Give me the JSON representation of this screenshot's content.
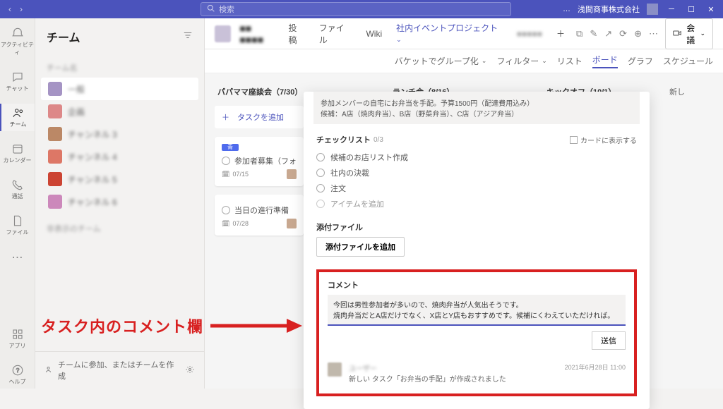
{
  "titlebar": {
    "search_placeholder": "検索",
    "org_name": "浅間商事株式会社",
    "ellipsis": "…"
  },
  "rail": {
    "activity": "アクティビティ",
    "chat": "チャット",
    "teams": "チーム",
    "calendar": "カレンダー",
    "calls": "通話",
    "files": "ファイル",
    "apps": "アプリ",
    "help": "ヘルプ"
  },
  "teams_panel": {
    "title": "チーム",
    "team_label_1": "チーム名",
    "ch1": "一般",
    "ch2": "企画",
    "ch3": "チャンネル 3",
    "ch4": "チャンネル 4",
    "ch5": "チャンネル 5",
    "ch6": "チャンネル 6",
    "hidden_label": "非表示のチーム",
    "footer": "チームに参加、またはチームを作成"
  },
  "channel_header": {
    "name": "■■ ■■■■",
    "tab_posts": "投稿",
    "tab_files": "ファイル",
    "tab_wiki": "Wiki",
    "tab_project": "社内イベントプロジェクト",
    "tab_other": "■■■■■",
    "meet_label": "会議"
  },
  "toolbar2": {
    "filter_bucket": "バケットでグループ化",
    "filter": "フィルター",
    "list": "リスト",
    "board": "ボード",
    "chart": "グラフ",
    "schedule": "スケジュール"
  },
  "board": {
    "col1_title": "パパママ座談会（7/30）",
    "col2_title": "ランチ会（8/16）",
    "col3_title": "キックオフ（10/1）",
    "add_task": "＋　タスクを追加",
    "new_list": "新し",
    "card1": {
      "tag": "青",
      "title": "参加者募集（フォ",
      "date": "07/15"
    },
    "card2": {
      "title": "当日の進行準備",
      "date": "07/28"
    }
  },
  "task": {
    "desc_line1": "参加メンバーの自宅にお弁当を手配。予算1500円（配達費用込み）",
    "desc_line2": "候補：A店（焼肉弁当）、B店（野菜弁当）、C店（アジア弁当）",
    "checklist_label": "チェックリスト",
    "checklist_count": "0/3",
    "display_in_card": "カードに表示する",
    "chk1": "候補のお店リスト作成",
    "chk2": "社内の決裁",
    "chk3": "注文",
    "chk_add": "アイテムを追加",
    "attach_label": "添付ファイル",
    "attach_btn": "添付ファイルを追加",
    "comment_label": "コメント",
    "comment_text_line1": "今回は男性参加者が多いので、焼肉弁当が人気出そうです。",
    "comment_text_line2": "焼肉弁当だとA店だけでなく、X店とY店もおすすめです。候補にくわえていただければ。",
    "send_btn": "送信",
    "activity_name": "ユーザー",
    "activity_text": "新しい タスク「お弁当の手配」が作成されました",
    "activity_time": "2021年6月28日 11:00"
  },
  "annotation": {
    "text": "タスク内のコメント欄"
  }
}
